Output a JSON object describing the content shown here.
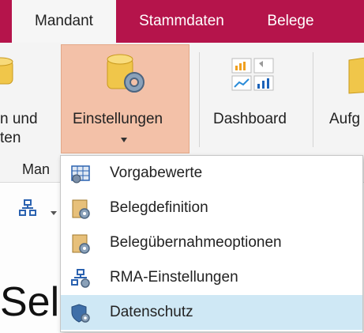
{
  "tabs": [
    {
      "label": "Mandant",
      "active": true
    },
    {
      "label": "Stammdaten",
      "active": false
    },
    {
      "label": "Belege",
      "active": false
    }
  ],
  "ribbon": {
    "partial_button_line1": "n und",
    "partial_button_line2": "ten",
    "settings_button": "Einstellungen",
    "dashboard_button": "Dashboard",
    "partial_right_button": "Aufg",
    "group_label_partial": "Man"
  },
  "menu": {
    "items": [
      {
        "label": "Vorgabewerte",
        "icon": "grid-settings-icon",
        "highlighted": false
      },
      {
        "label": "Belegdefinition",
        "icon": "document-gear-icon",
        "highlighted": false
      },
      {
        "label": "Belegübernahmeoptionen",
        "icon": "document-gear-icon",
        "highlighted": false
      },
      {
        "label": "RMA-Einstellungen",
        "icon": "hierarchy-gear-icon",
        "highlighted": false
      },
      {
        "label": "Datenschutz",
        "icon": "shield-gear-icon",
        "highlighted": true
      }
    ]
  },
  "page": {
    "heading_partial": "Sel"
  },
  "colors": {
    "tab_strip": "#b5144b",
    "ribbon_bg": "#f4f4f4",
    "selected_button": "#f3c1a8",
    "menu_highlight": "#cfe8f5"
  }
}
